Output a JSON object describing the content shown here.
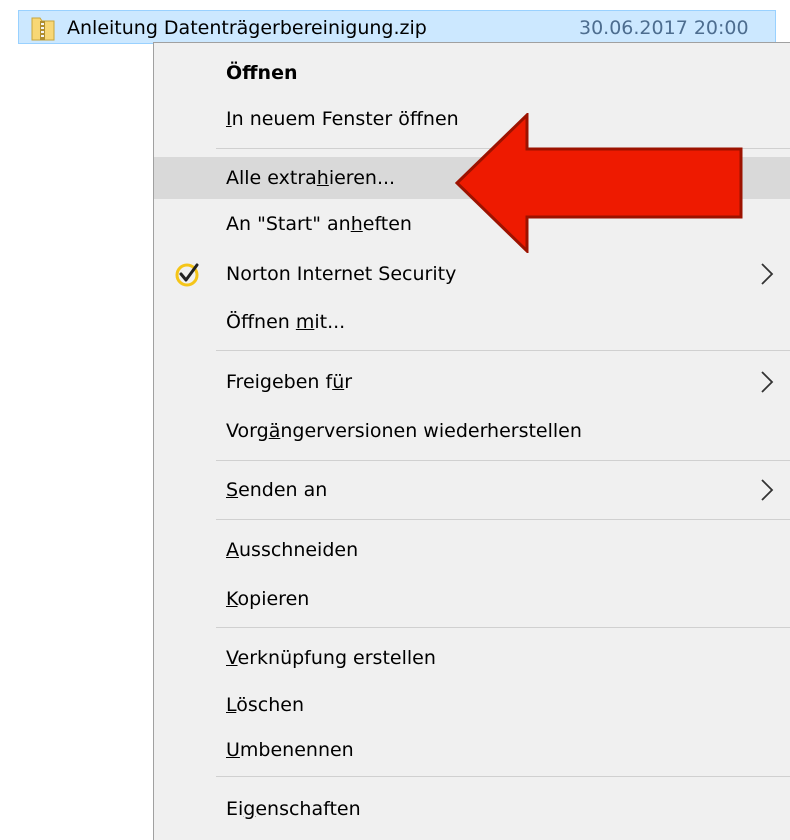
{
  "file": {
    "name": "Anleitung Datenträgerbereinigung.zip",
    "date": "30.06.2017 20:00",
    "icon": "zip-folder-icon"
  },
  "menu": {
    "items": [
      {
        "key": "open",
        "label": "Öffnen",
        "underline": "",
        "bold": true
      },
      {
        "key": "open-new-window",
        "label": "In neuem Fenster öffnen",
        "underline": "I"
      },
      {
        "key": "extract-all",
        "label": "Alle extrahieren...",
        "underline": "h",
        "highlighted": true
      },
      {
        "key": "pin-start",
        "label": "An \"Start\" anheften",
        "underline": "h"
      },
      {
        "key": "norton",
        "label": "Norton Internet Security",
        "underline": "",
        "icon": "norton-check-icon",
        "submenu": true
      },
      {
        "key": "open-with",
        "label": "Öffnen mit...",
        "underline": "m"
      },
      {
        "key": "share-with",
        "label": "Freigeben für",
        "underline": "ü",
        "submenu": true
      },
      {
        "key": "restore-previous",
        "label": "Vorgängerversionen wiederherstellen",
        "underline": "ä"
      },
      {
        "key": "send-to",
        "label": "Senden an",
        "underline": "S",
        "submenu": true
      },
      {
        "key": "cut",
        "label": "Ausschneiden",
        "underline": "A"
      },
      {
        "key": "copy",
        "label": "Kopieren",
        "underline": "K"
      },
      {
        "key": "create-shortcut",
        "label": "Verknüpfung erstellen",
        "underline": "V"
      },
      {
        "key": "delete",
        "label": "Löschen",
        "underline": "L"
      },
      {
        "key": "rename",
        "label": "Umbenennen",
        "underline": "U"
      },
      {
        "key": "properties",
        "label": "Eigenschaften",
        "underline": "g"
      }
    ]
  },
  "colors": {
    "selection": "#cce8ff",
    "menu_background": "#f0f0f0",
    "highlight": "#d9d9d9",
    "annotation_arrow": "#ee1a00",
    "norton_yellow": "#f5c518"
  }
}
